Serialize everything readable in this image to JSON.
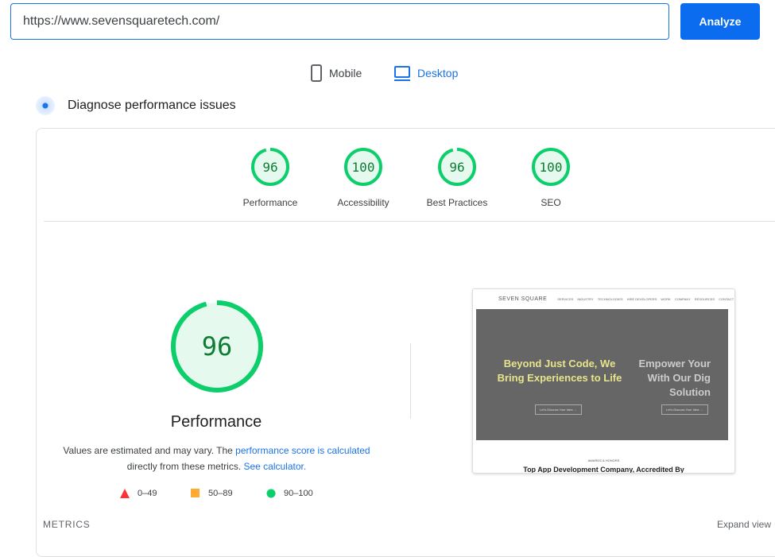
{
  "search": {
    "url": "https://www.sevensquaretech.com/",
    "button": "Analyze"
  },
  "device_tabs": [
    {
      "label": "Mobile",
      "active": false
    },
    {
      "label": "Desktop",
      "active": true
    }
  ],
  "diagnose": {
    "title": "Diagnose performance issues"
  },
  "scores": [
    {
      "label": "Performance",
      "value": "96"
    },
    {
      "label": "Accessibility",
      "value": "100"
    },
    {
      "label": "Best Practices",
      "value": "96"
    },
    {
      "label": "SEO",
      "value": "100"
    }
  ],
  "main_gauge": {
    "value": "96",
    "label": "Performance",
    "fraction": 0.96
  },
  "description": {
    "text1": "Values are estimated and may vary. The ",
    "link1": "performance score is calculated",
    "text2": "directly from these metrics. ",
    "link2": "See calculator."
  },
  "legend": [
    {
      "range": "0–49",
      "color": "#ff3333",
      "shape": "triangle"
    },
    {
      "range": "50–89",
      "color": "#ffaa33",
      "shape": "square"
    },
    {
      "range": "90–100",
      "color": "#0cce6b",
      "shape": "circle"
    }
  ],
  "screenshot": {
    "brand": "SEVEN SQUARE",
    "nav": [
      "SERVICES",
      "INDUSTRY",
      "TECHNOLOGIES",
      "HIRE DEVELOPERS",
      "WORK",
      "COMPANY",
      "RESOURCES",
      "CONTACT"
    ],
    "headline1": "Beyond Just Code, We Bring Experiences to Life",
    "headline2": "Empower Your With Our Dig Solution",
    "cta": "Let's Discuss Your Idea →",
    "awards": "AWARDS & HONORS",
    "bottom": "Top App Development Company, Accredited By"
  },
  "metrics": {
    "label": "METRICS",
    "expand": "Expand view"
  },
  "colors": {
    "accent": "#1a73e8",
    "pass": "#0cce6b",
    "pass_text": "#0c7d33",
    "pass_bg": "#e6f9ee"
  }
}
